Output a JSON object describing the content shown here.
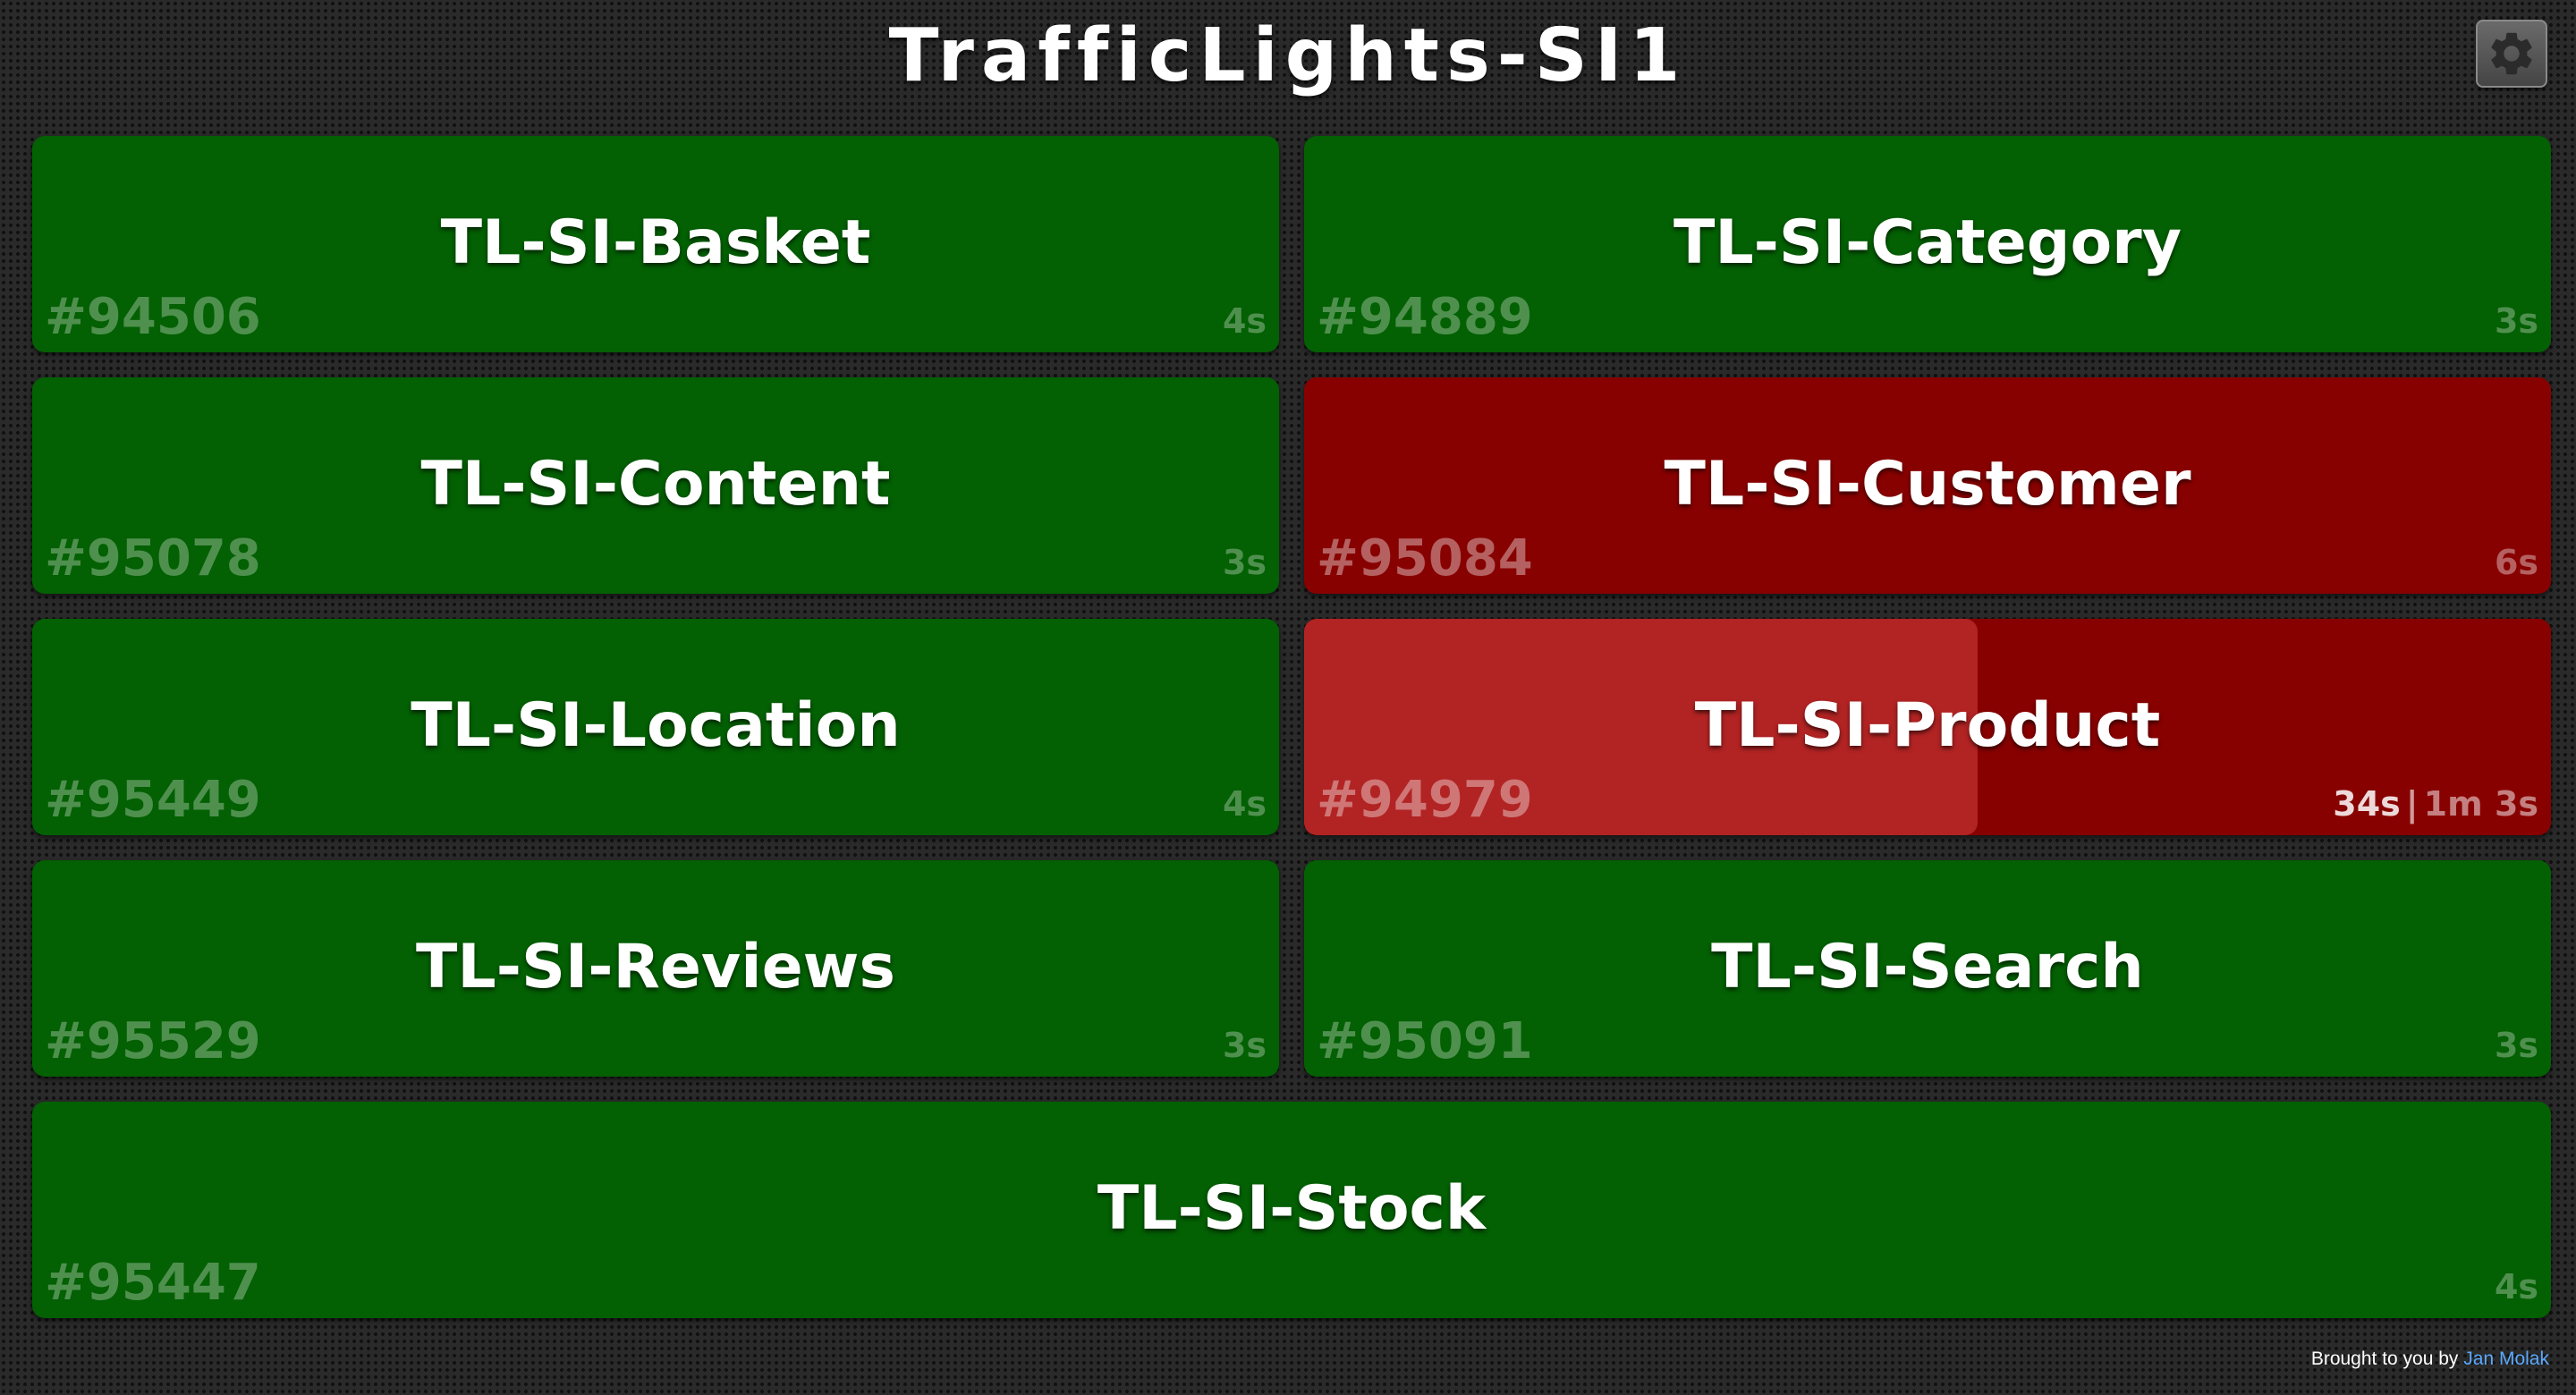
{
  "header": {
    "title": "TrafficLights-SI1",
    "settings_icon": "gear-icon"
  },
  "colors": {
    "success": "#036003",
    "failure": "#880101",
    "building_progress": "#b22323"
  },
  "tiles": [
    {
      "name": "TL-SI-Basket",
      "build": "#94506",
      "duration": "4s",
      "status": "success"
    },
    {
      "name": "TL-SI-Category",
      "build": "#94889",
      "duration": "3s",
      "status": "success"
    },
    {
      "name": "TL-SI-Content",
      "build": "#95078",
      "duration": "3s",
      "status": "success"
    },
    {
      "name": "TL-SI-Customer",
      "build": "#95084",
      "duration": "6s",
      "status": "failure"
    },
    {
      "name": "TL-SI-Location",
      "build": "#95449",
      "duration": "4s",
      "status": "success"
    },
    {
      "name": "TL-SI-Product",
      "build": "#94979",
      "elapsed": "34s",
      "separator": "|",
      "estimated": "1m 3s",
      "status": "failure-building",
      "progress_fraction": 0.54
    },
    {
      "name": "TL-SI-Reviews",
      "build": "#95529",
      "duration": "3s",
      "status": "success"
    },
    {
      "name": "TL-SI-Search",
      "build": "#95091",
      "duration": "3s",
      "status": "success"
    },
    {
      "name": "TL-SI-Stock",
      "build": "#95447",
      "duration": "4s",
      "status": "success"
    }
  ],
  "footer": {
    "text": "Brought to you by",
    "link_text": "Jan Molak"
  }
}
